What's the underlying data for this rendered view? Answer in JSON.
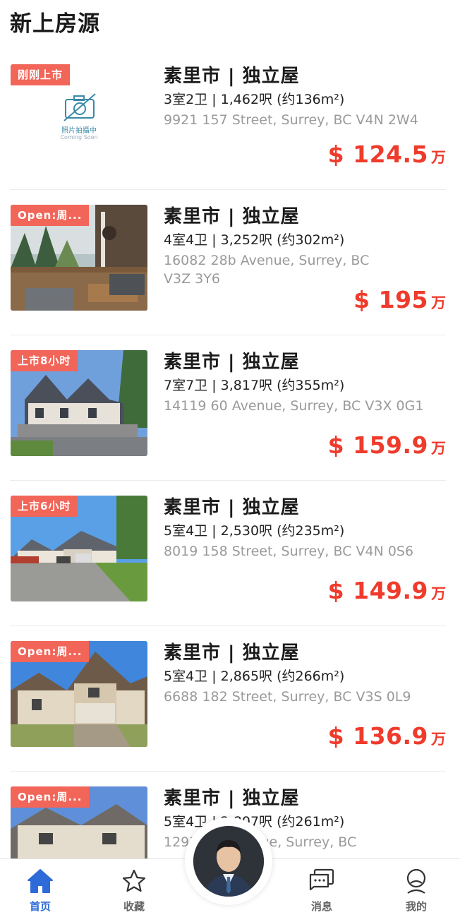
{
  "page": {
    "title": "新上房源"
  },
  "listings": [
    {
      "badge": "刚刚上市",
      "title": "素里市 | 独立屋",
      "specs": "3室2卫 | 1,462呎 (约136m²)",
      "address": "9921 157 Street, Surrey, BC V4N 2W4",
      "price": "$ 124.5",
      "unit": "万",
      "placeholder_text": "照片拍攝中",
      "placeholder_sub": "Coming Soon"
    },
    {
      "badge": "Open:周...",
      "title": "素里市 | 独立屋",
      "specs": "4室4卫 | 3,252呎 (约302m²)",
      "address": "16082 28b Avenue, Surrey, BC V3Z 3Y6",
      "price": "$ 195",
      "unit": "万"
    },
    {
      "badge": "上市8小时",
      "title": "素里市 | 独立屋",
      "specs": "7室7卫 | 3,817呎 (约355m²)",
      "address": "14119 60 Avenue, Surrey, BC V3X 0G1",
      "price": "$ 159.9",
      "unit": "万"
    },
    {
      "badge": "上市6小时",
      "title": "素里市 | 独立屋",
      "specs": "5室4卫 | 2,530呎 (约235m²)",
      "address": "8019 158 Street, Surrey, BC V4N 0S6",
      "price": "$ 149.9",
      "unit": "万"
    },
    {
      "badge": "Open:周...",
      "title": "素里市 | 独立屋",
      "specs": "5室4卫 | 2,865呎 (约266m²)",
      "address": "6688 182 Street, Surrey, BC V3S 0L9",
      "price": "$ 136.9",
      "unit": "万"
    },
    {
      "badge": "Open:周...",
      "title": "素里市 | 独立屋",
      "specs": "5室4卫 | 2,807呎 (约261m²)",
      "address": "12931 ... Avenue, Surrey, BC",
      "price": "",
      "unit": ""
    }
  ],
  "tabbar": {
    "home": "首页",
    "favorites": "收藏",
    "messages": "消息",
    "mine": "我的"
  },
  "colors": {
    "accent": "#2f6bd8",
    "price": "#ef3b2c",
    "badge": "#f26559"
  }
}
